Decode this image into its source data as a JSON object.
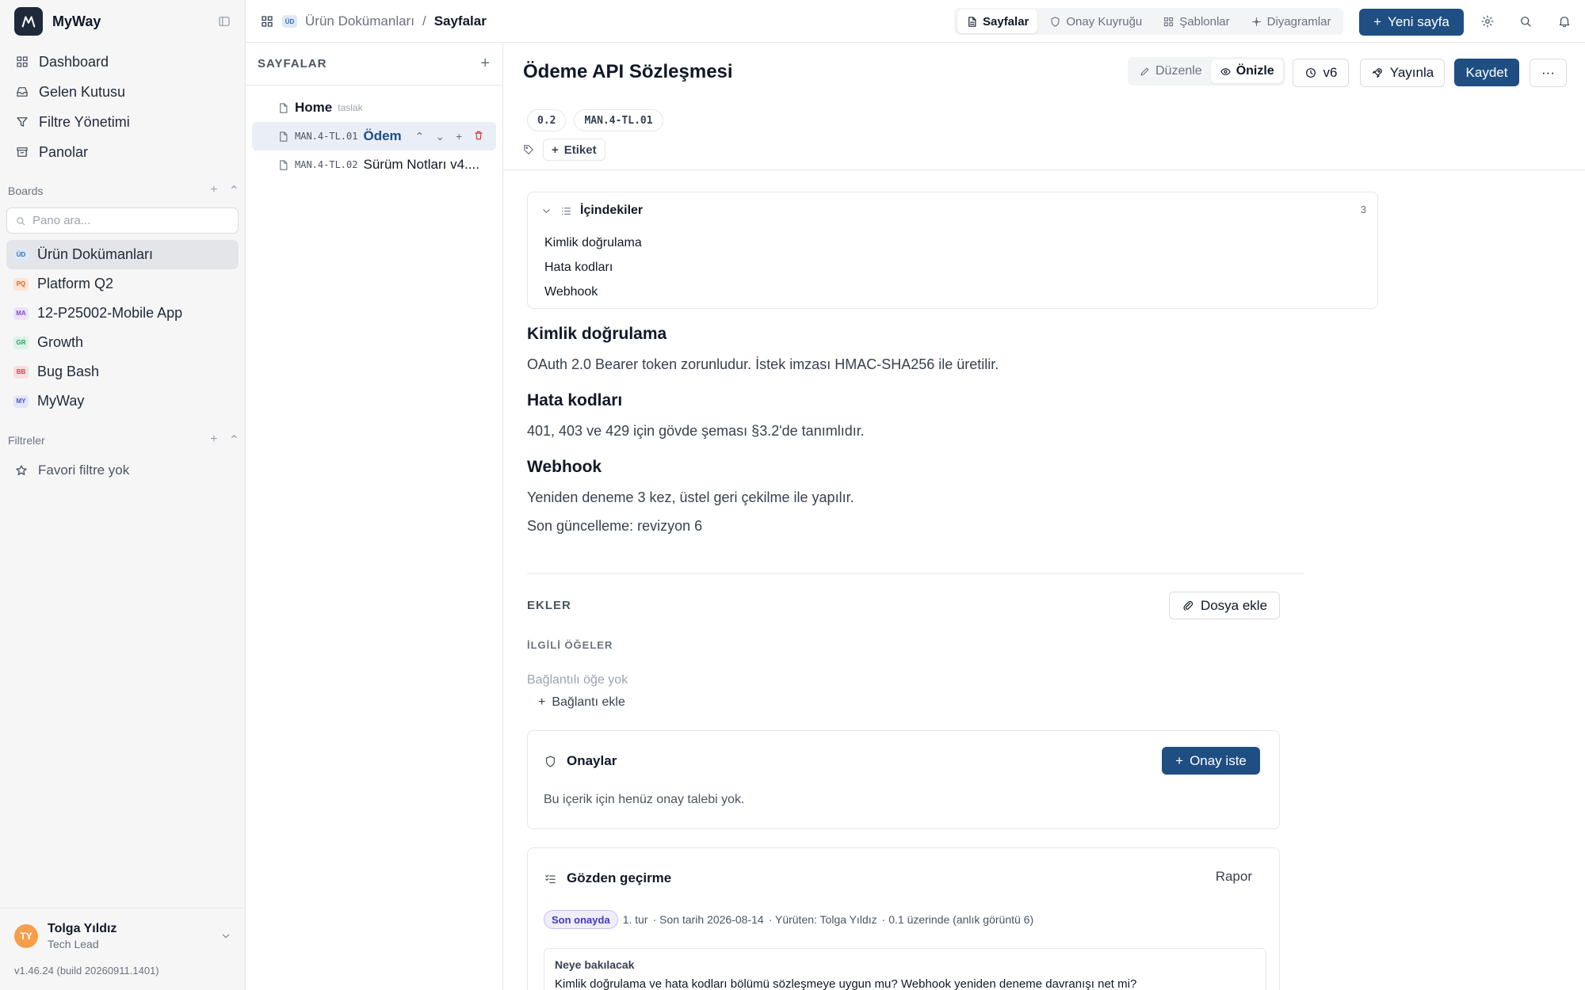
{
  "app": {
    "name": "MyWay",
    "version": "v1.46.24 (build 20260911.1401)"
  },
  "sidebar": {
    "nav": [
      {
        "label": "Dashboard",
        "icon": "grid-icon"
      },
      {
        "label": "Gelen Kutusu",
        "icon": "inbox-icon"
      },
      {
        "label": "Filtre Yönetimi",
        "icon": "filter-icon"
      },
      {
        "label": "Panolar",
        "icon": "archive-icon"
      }
    ],
    "boards_label": "Boards",
    "board_search_placeholder": "Pano ara...",
    "boards": [
      {
        "code": "ÜD",
        "label": "Ürün Dokümanları",
        "badge_bg": "#dde8f8",
        "badge_fg": "#3b6db3",
        "active": true
      },
      {
        "code": "PQ",
        "label": "Platform Q2",
        "badge_bg": "#fde4d4",
        "badge_fg": "#d2692a"
      },
      {
        "code": "MA",
        "label": "12-P25002-Mobile App",
        "badge_bg": "#ece3fa",
        "badge_fg": "#7c4dcc"
      },
      {
        "code": "GR",
        "label": "Growth",
        "badge_bg": "#d9f3e6",
        "badge_fg": "#2f9e63"
      },
      {
        "code": "BB",
        "label": "Bug Bash",
        "badge_bg": "#fbdde0",
        "badge_fg": "#d1414f"
      },
      {
        "code": "MY",
        "label": "MyWay",
        "badge_bg": "#e3e6fa",
        "badge_fg": "#4b55c4"
      }
    ],
    "filters_label": "Filtreler",
    "no_favorite": "Favori filtre yok",
    "user": {
      "initials": "TY",
      "name": "Tolga Yıldız",
      "role": "Tech Lead"
    }
  },
  "topbar": {
    "breadcrumb_badge": "ÜD",
    "breadcrumb_board": "Ürün Dokümanları",
    "breadcrumb_sep": "/",
    "breadcrumb_current": "Sayfalar",
    "tabs": [
      {
        "label": "Sayfalar",
        "active": true
      },
      {
        "label": "Onay Kuyruğu"
      },
      {
        "label": "Şablonlar"
      },
      {
        "label": "Diyagramlar"
      }
    ],
    "new_page": "Yeni sayfa"
  },
  "pages_panel": {
    "title": "SAYFALAR",
    "items": [
      {
        "code": "",
        "title": "Home",
        "note": "taslak"
      },
      {
        "code": "MAN.4-TL.01",
        "title": "Ödem",
        "active": true
      },
      {
        "code": "MAN.4-TL.02",
        "title": "Sürüm Notları v4...."
      }
    ]
  },
  "doc": {
    "title": "Ödeme API Sözleşmesi",
    "mode_edit": "Düzenle",
    "mode_preview": "Önizle",
    "version": "v6",
    "publish": "Yayınla",
    "save": "Kaydet",
    "more": "···",
    "chips": [
      "0.2",
      "MAN.4-TL.01"
    ],
    "tag_button": "Etiket",
    "toc": {
      "title": "İçindekiler",
      "count": "3",
      "items": [
        "Kimlik doğrulama",
        "Hata kodları",
        "Webhook"
      ]
    },
    "sections": [
      {
        "heading": "Kimlik doğrulama",
        "text": "OAuth 2.0 Bearer token zorunludur. İstek imzası HMAC-SHA256 ile üretilir."
      },
      {
        "heading": "Hata kodları",
        "text": "401, 403 ve 429 için gövde şeması §3.2'de tanımlıdır."
      },
      {
        "heading": "Webhook",
        "text": "Yeniden deneme 3 kez, üstel geri çekilme ile yapılır."
      }
    ],
    "last_update": "Son güncelleme: revizyon 6",
    "attachments_label": "EKLER",
    "attach_button": "Dosya ekle",
    "related_label": "İLGİLİ ÖĞELER",
    "related_empty": "Bağlantılı öğe yok",
    "add_link": "Bağlantı ekle",
    "approvals": {
      "title": "Onaylar",
      "button": "Onay iste",
      "empty": "Bu içerik için henüz onay talebi yok."
    },
    "review": {
      "title": "Gözden geçirme",
      "report": "Rapor",
      "status": "Son onayda",
      "round": "1. tur",
      "due": "· Son tarih 2026-08-14",
      "owner": "· Yürüten: Tolga Yıldız",
      "base": "· 0.1 üzerinde (anlık görüntü 6)",
      "look_title": "Neye bakılacak",
      "look_text": "Kimlik doğrulama ve hata kodları bölümü sözleşmeye uygun mu? Webhook yeniden deneme davranışı net mi?"
    }
  },
  "colors": {
    "primary": "#1f4e82",
    "danger": "#dc2626",
    "status_bg": "#efedfc",
    "status_fg": "#4338ca"
  }
}
